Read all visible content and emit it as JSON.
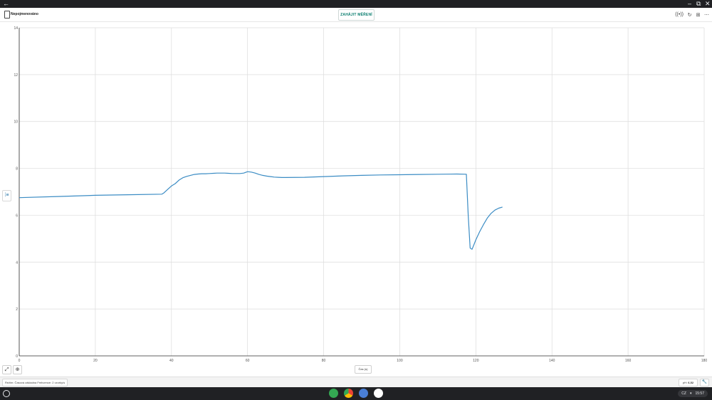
{
  "titlebar": {
    "back": "←",
    "minimize": "–",
    "restore": "⧉",
    "close": "✕"
  },
  "app": {
    "document_title": "Nepojmenováno",
    "start_button": "ZAHÁJIT MĚŘENÍ",
    "actions": {
      "sensor": "((•))",
      "refresh": "↻",
      "layout": "⊞",
      "more": "⋯"
    }
  },
  "chart_data": {
    "type": "line",
    "xlabel": "Čas (s)",
    "ylabel": "",
    "xlim": [
      0,
      180
    ],
    "ylim": [
      0,
      14
    ],
    "x_ticks": [
      "0",
      "20",
      "40",
      "60",
      "80",
      "100",
      "120",
      "140",
      "160",
      "180"
    ],
    "y_ticks": [
      "0",
      "2",
      "4",
      "6",
      "8",
      "10",
      "12",
      "14"
    ],
    "grid": true,
    "series": [
      {
        "color": "#3b8cc4",
        "x": [
          0,
          10,
          20,
          30,
          37.5,
          38,
          39,
          40,
          41,
          42,
          43,
          44,
          45,
          46,
          47,
          48,
          49,
          50,
          51,
          52,
          53,
          54,
          55,
          56,
          57,
          58,
          59,
          60,
          61,
          62,
          63,
          64,
          65,
          66,
          67,
          68,
          69,
          70,
          75,
          80,
          85,
          90,
          95,
          100,
          105,
          110,
          115,
          117.5,
          118,
          118.5,
          119,
          119.5,
          120,
          121,
          122,
          123,
          124,
          125,
          126,
          127
        ],
        "y": [
          6.75,
          6.8,
          6.85,
          6.88,
          6.9,
          6.95,
          7.1,
          7.25,
          7.35,
          7.5,
          7.6,
          7.66,
          7.7,
          7.74,
          7.76,
          7.77,
          7.77,
          7.78,
          7.79,
          7.8,
          7.8,
          7.8,
          7.79,
          7.78,
          7.78,
          7.78,
          7.8,
          7.86,
          7.84,
          7.8,
          7.74,
          7.7,
          7.67,
          7.65,
          7.63,
          7.62,
          7.61,
          7.61,
          7.62,
          7.65,
          7.68,
          7.7,
          7.72,
          7.73,
          7.74,
          7.75,
          7.76,
          7.75,
          6.0,
          4.6,
          4.55,
          4.75,
          4.95,
          5.3,
          5.6,
          5.88,
          6.08,
          6.22,
          6.3,
          6.35
        ]
      }
    ]
  },
  "toolbar_bottom": {
    "graph_tool": "⤢",
    "zoom_tool": "⊕"
  },
  "status": {
    "mode_text": "Režim: Časová základna   Frekvence: 2 vzorky/s",
    "ph_label": "pH:",
    "ph_value": "6,52",
    "wrench": "🔧"
  },
  "taskbar": {
    "apps": [
      {
        "name": "play-store",
        "color": "#34a853"
      },
      {
        "name": "chrome",
        "color": "#ea4335"
      },
      {
        "name": "settings",
        "color": "#4a7fd6"
      },
      {
        "name": "app",
        "color": "#ffffff"
      }
    ],
    "locale": "CZ",
    "time": "15:57",
    "wifi": "▾"
  }
}
